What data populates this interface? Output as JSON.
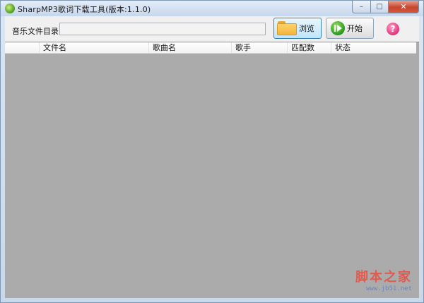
{
  "window": {
    "title": "SharpMP3歌词下载工具(版本:1.1.0)",
    "controls": {
      "minimize": "–",
      "maximize": "□",
      "close": "✕"
    }
  },
  "toolbar": {
    "dir_label": "音乐文件目录:",
    "dir_value": "",
    "browse_label": "浏览",
    "start_label": "开始",
    "help_glyph": "?"
  },
  "table": {
    "columns": [
      "",
      "文件名",
      "歌曲名",
      "歌手",
      "匹配数",
      "状态"
    ],
    "rows": []
  },
  "watermark": {
    "text": "脚本之家",
    "url": "www.jb51.net"
  },
  "icons": {
    "app": "app-logo-icon",
    "browse": "folder-icon",
    "start": "play-icon",
    "help": "help-icon"
  },
  "colors": {
    "grid_background": "#ababab",
    "watermark": "#e05a4e",
    "help": "#e2337b"
  }
}
